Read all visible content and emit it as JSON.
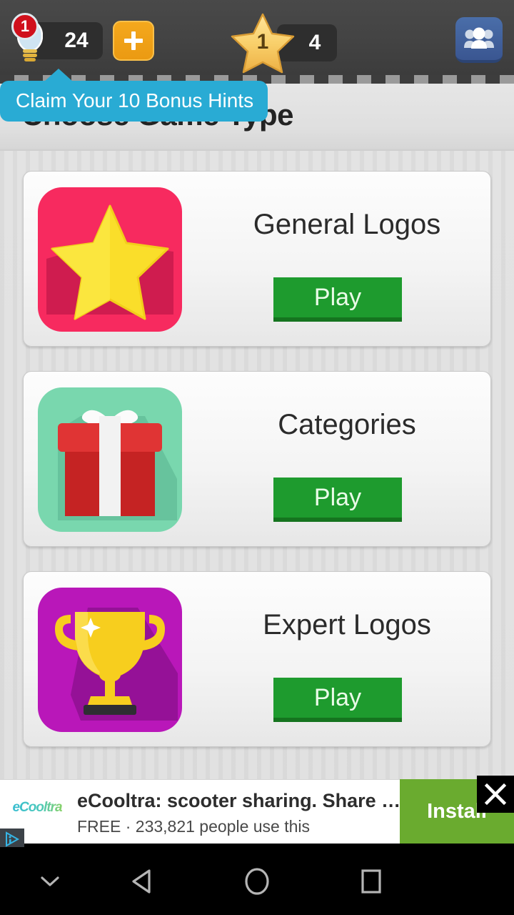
{
  "topbar": {
    "hint_badge": "1",
    "hint_count": "24",
    "add_hints_label": "+",
    "star_level": "1",
    "star_count": "4",
    "icons": {
      "bulb": "lightbulb-icon",
      "star": "star-icon",
      "friends": "friends-icon",
      "plus": "plus-icon"
    },
    "colors": {
      "bar_bg": "#434343",
      "pill_bg": "#2e2e2e",
      "badge_red": "#d0101c",
      "plus_orange": "#eb9a12",
      "facebook_blue": "#3a5691"
    }
  },
  "tooltip": {
    "text": "Claim Your 10 Bonus Hints",
    "color": "#29ABD4"
  },
  "header": {
    "title": "Choose Game Type"
  },
  "main": {
    "cards": [
      {
        "name": "General Logos",
        "play_label": "Play",
        "icon": "star-tile-icon",
        "tile_color": "#F72A5F",
        "tile_shadow": "#C81A4C",
        "art_color": "#FADE2A"
      },
      {
        "name": "Categories",
        "play_label": "Play",
        "icon": "gift-tile-icon",
        "tile_color": "#79D7AE",
        "tile_shadow": "#63BE98",
        "art_color": "#CF2B2B"
      },
      {
        "name": "Expert Logos",
        "play_label": "Play",
        "icon": "trophy-tile-icon",
        "tile_color": "#B917B9",
        "tile_shadow": "#8E1190",
        "art_color": "#F7CE1E"
      }
    ],
    "play_button_color": "#1E9B2E"
  },
  "ad": {
    "brand": "eCooltra",
    "title": "eCooltra: scooter sharing. Share …",
    "subtitle": "FREE · 233,821 people use this",
    "install_label": "Install",
    "close_label": "✕",
    "install_color": "#6aab2f",
    "adchoices_icon": "adchoices-icon"
  },
  "navbar": {
    "items": [
      {
        "icon": "chevron-down-icon",
        "name": "hide-icon"
      },
      {
        "icon": "back-triangle-icon",
        "name": "back-button"
      },
      {
        "icon": "home-circle-icon",
        "name": "home-button"
      },
      {
        "icon": "recents-square-icon",
        "name": "recents-button"
      }
    ]
  }
}
